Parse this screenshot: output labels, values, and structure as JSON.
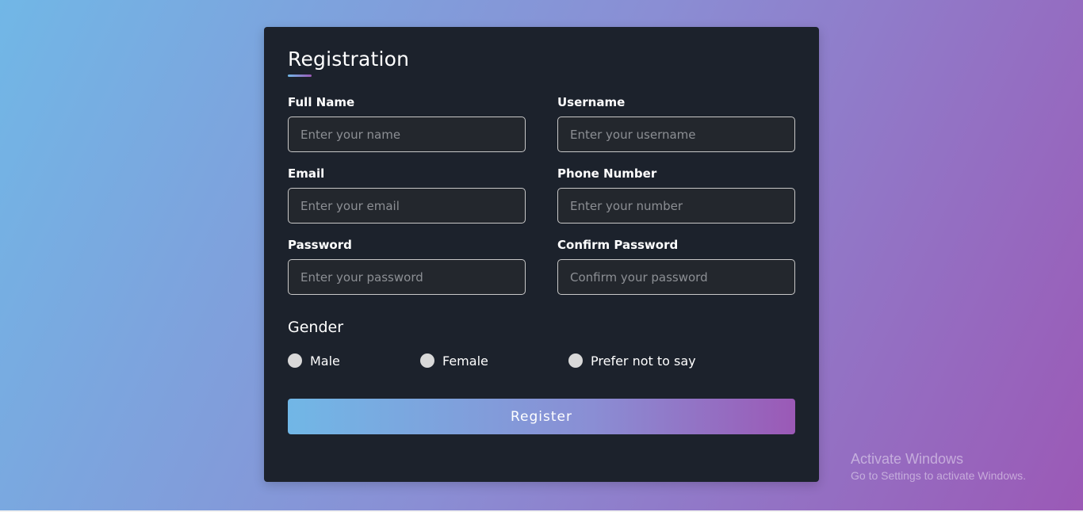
{
  "form": {
    "title": "Registration",
    "fields": [
      {
        "label": "Full Name",
        "placeholder": "Enter your name",
        "value": ""
      },
      {
        "label": "Username",
        "placeholder": "Enter your username",
        "value": ""
      },
      {
        "label": "Email",
        "placeholder": "Enter your email",
        "value": ""
      },
      {
        "label": "Phone Number",
        "placeholder": "Enter your number",
        "value": ""
      },
      {
        "label": "Password",
        "placeholder": "Enter your password",
        "value": ""
      },
      {
        "label": "Confirm Password",
        "placeholder": "Confirm your password",
        "value": ""
      }
    ],
    "gender": {
      "title": "Gender",
      "options": [
        "Male",
        "Female",
        "Prefer not to say"
      ]
    },
    "submit_label": "Register"
  },
  "watermark": {
    "title": "Activate Windows",
    "subtitle": "Go to Settings to activate Windows."
  },
  "colors": {
    "gradient_start": "#71b7e6",
    "gradient_end": "#9b59b6",
    "card_background": "#1c222c"
  }
}
